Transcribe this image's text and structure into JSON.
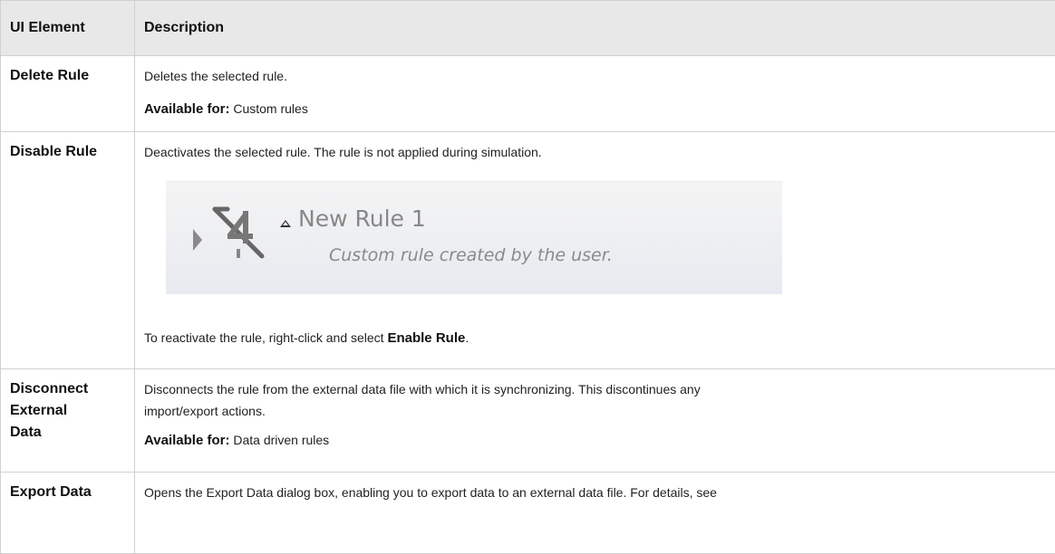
{
  "table": {
    "headers": {
      "element": "UI Element",
      "description": "Description"
    },
    "rows": {
      "delete": {
        "element": "Delete Rule",
        "desc": "Deletes the selected rule.",
        "avail_label": "Available for:",
        "avail_value": "Custom rules"
      },
      "disable": {
        "element": "Disable Rule",
        "desc": "Deactivates the selected rule. The rule is not applied during simulation.",
        "image": {
          "rule_name": "New Rule 1",
          "rule_desc": "Custom rule created by the user."
        },
        "note_before": "To reactivate the rule, right-click and select ",
        "note_keyword": "Enable Rule",
        "note_after": "."
      },
      "disconnect": {
        "element_line1": "Disconnect",
        "element_line2": "External",
        "element_line3": "Data",
        "desc_line1": "Disconnects the rule from the external data file with which it is synchronizing. This discontinues any",
        "desc_line2": "import/export actions.",
        "avail_label": "Available for:",
        "avail_value": "Data driven rules"
      },
      "export": {
        "element": "Export Data",
        "desc": "Opens the Export Data dialog box, enabling you to export data to an external data file. For details, see"
      }
    }
  }
}
